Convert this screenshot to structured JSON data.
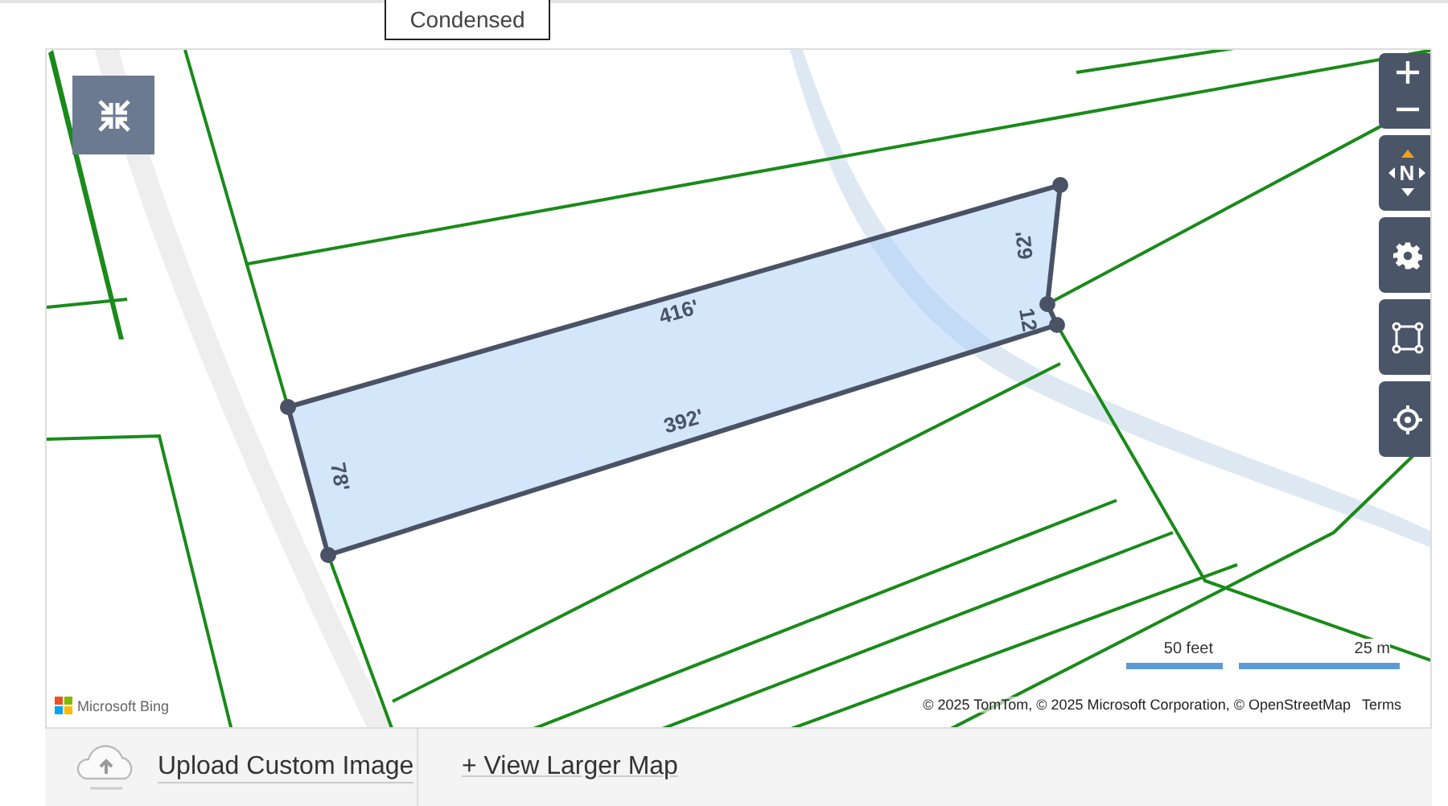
{
  "tabs": [
    {
      "label": "Condensed",
      "selected": true
    }
  ],
  "map": {
    "kind": "picture",
    "parcel": {
      "edges": [
        {
          "label": "416'"
        },
        {
          "label": "392'"
        },
        {
          "label": "78'"
        },
        {
          "label": "62'"
        },
        {
          "label": "12'"
        }
      ]
    },
    "compass": {
      "label": "N"
    },
    "scale_bar": [
      {
        "label": "50 feet"
      },
      {
        "label": "25 m"
      }
    ],
    "logo": "Microsoft Bing",
    "attribution": "© 2025 TomTom, © 2025 Microsoft Corporation, © OpenStreetMap",
    "terms": "Terms"
  },
  "footer": {
    "upload": "Upload Custom Image",
    "view_larger": "+ View Larger Map"
  }
}
